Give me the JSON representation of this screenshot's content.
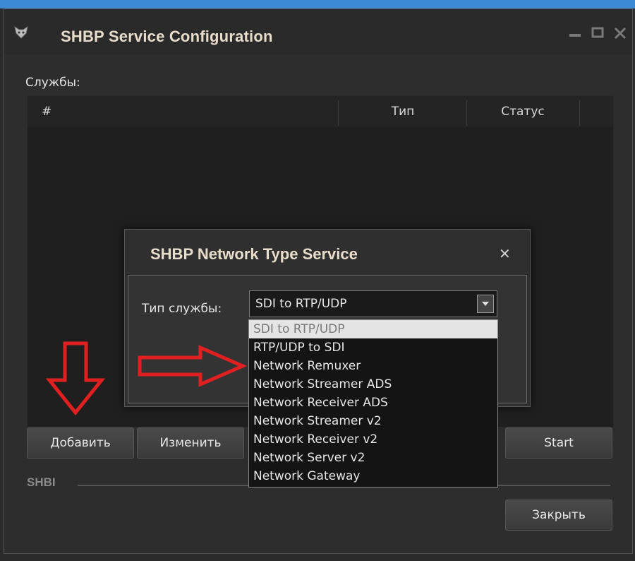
{
  "window": {
    "title": "SHBP Service Configuration",
    "controls": [
      "minimize",
      "maximize",
      "close"
    ]
  },
  "services": {
    "label": "Службы:",
    "columns": [
      "#",
      "Тип",
      "Статус"
    ]
  },
  "buttons": {
    "add": "Добавить",
    "edit": "Изменить",
    "start": "Start",
    "close": "Закрыть"
  },
  "section": {
    "label": "SHBI"
  },
  "dialog": {
    "title": "SHBP Network Type Service",
    "close_glyph": "✕",
    "type_label": "Тип службы:",
    "selected": "SDI to RTP/UDP",
    "options": [
      "SDI to RTP/UDP",
      "RTP/UDP to SDI",
      "Network Remuxer",
      "Network Streamer ADS",
      "Network Receiver ADS",
      "Network Streamer v2",
      "Network Receiver v2",
      "Network Server v2",
      "Network Gateway"
    ]
  },
  "colors": {
    "title": "#e8dccb",
    "annotation_arrow": "#e02020",
    "titlebar_accent": "#3c8ad6"
  },
  "icons": {
    "app": "fox-head-icon",
    "minimize": "minimize-icon",
    "maximize": "maximize-icon",
    "close": "close-icon",
    "annotation_down": "arrow-down-icon",
    "annotation_right": "arrow-right-icon"
  }
}
